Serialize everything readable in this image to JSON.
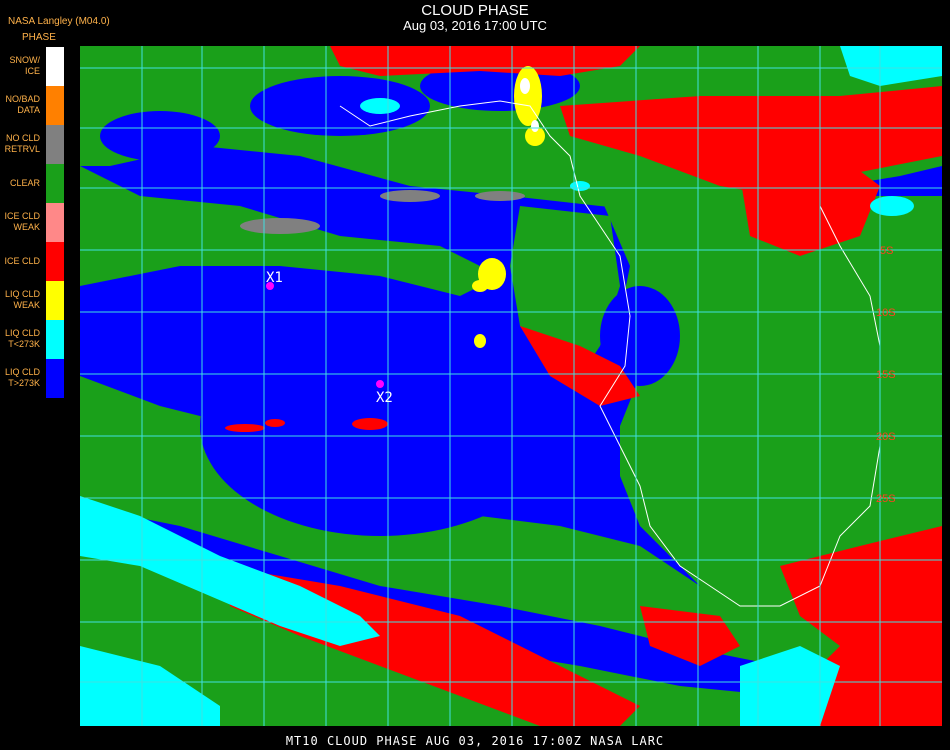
{
  "header": {
    "title": "CLOUD PHASE",
    "subtitle": "Aug 03, 2016 17:00 UTC",
    "credit": "NASA Langley (M04.0)",
    "legend_title": "PHASE"
  },
  "legend": [
    {
      "line1": "SNOW/",
      "line2": "ICE",
      "color": "#ffffff"
    },
    {
      "line1": "NO/BAD",
      "line2": "DATA",
      "color": "#ff8000"
    },
    {
      "line1": "NO CLD",
      "line2": "RETRVL",
      "color": "#808080"
    },
    {
      "line1": "CLEAR",
      "line2": "",
      "color": "#1aa01a"
    },
    {
      "line1": "ICE CLD",
      "line2": "WEAK",
      "color": "#ff8888"
    },
    {
      "line1": "ICE CLD",
      "line2": "",
      "color": "#ff0000"
    },
    {
      "line1": "LIQ CLD",
      "line2": "WEAK",
      "color": "#ffff00"
    },
    {
      "line1": "LIQ CLD",
      "line2": "T<273K",
      "color": "#00ffff"
    },
    {
      "line1": "LIQ CLD",
      "line2": "T>273K",
      "color": "#0000ff"
    }
  ],
  "markers": [
    {
      "label": "X1"
    },
    {
      "label": "X2"
    }
  ],
  "lat_labels": [
    "5S",
    "10S",
    "15S",
    "20S",
    "25S"
  ],
  "footer": "MT10  CLOUD PHASE   AUG 03, 2016 17:00Z   NASA LARC"
}
